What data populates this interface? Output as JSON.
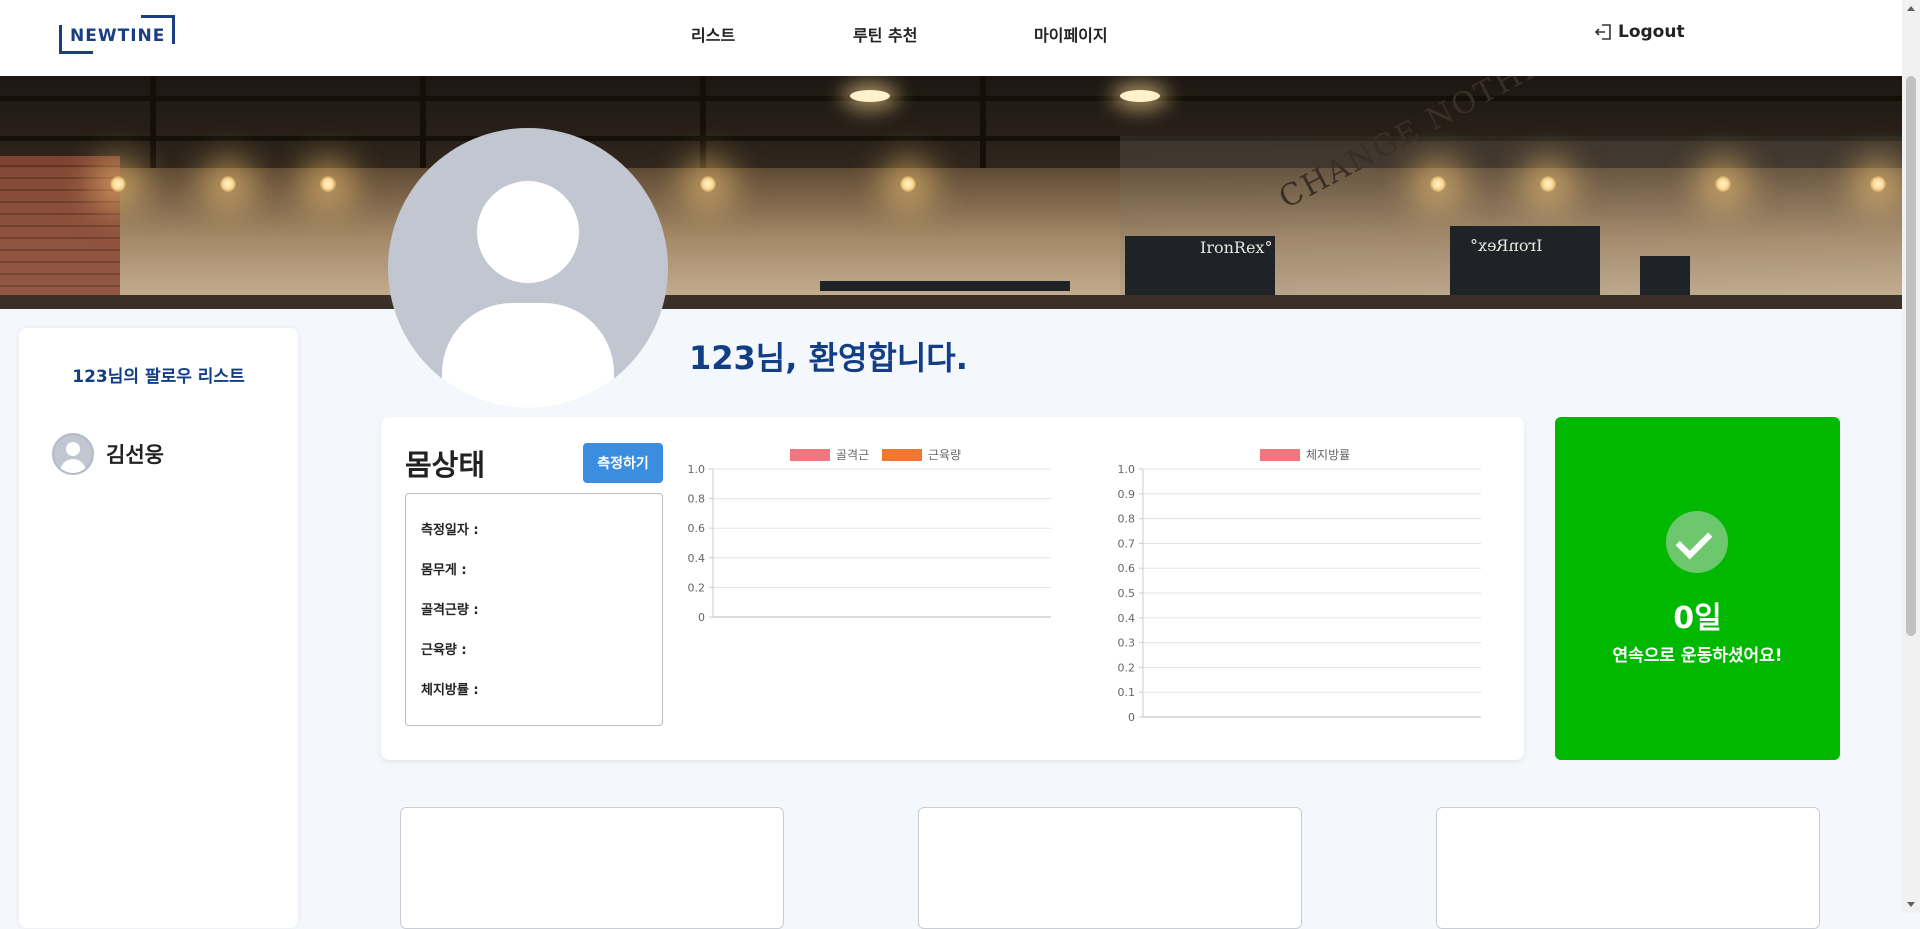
{
  "header": {
    "logo_text": "NEWTINE",
    "nav": [
      "리스트",
      "루틴 추천",
      "마이페이지"
    ],
    "logout_label": "Logout"
  },
  "banner": {
    "wall_text": "CHANGE NOTHI",
    "rack_labels": [
      "IronRex°",
      "IronRex°"
    ]
  },
  "profile": {
    "welcome": "123님, 환영합니다."
  },
  "sidebar": {
    "title": "123님의 팔로우 리스트",
    "follows": [
      {
        "name": "김선웅"
      }
    ]
  },
  "body_state": {
    "title": "몸상태",
    "measure_button": "측정하기",
    "fields": [
      {
        "label": "측정일자 :",
        "value": ""
      },
      {
        "label": "몸무게 :",
        "value": ""
      },
      {
        "label": "골격근량 :",
        "value": ""
      },
      {
        "label": "근육량 :",
        "value": ""
      },
      {
        "label": "체지방률 :",
        "value": ""
      }
    ]
  },
  "streak": {
    "days": "0일",
    "message": "연속으로 운동하셨어요!",
    "color": "#00b800"
  },
  "colors": {
    "brand": "#123e86",
    "button": "#3b8de0",
    "series_pink": "#f07680",
    "series_orange": "#f07830"
  },
  "chart_data": [
    {
      "type": "line",
      "title": "",
      "legend_position": "top",
      "series": [
        {
          "name": "골격근",
          "values": [],
          "color": "#f07680"
        },
        {
          "name": "근육량",
          "values": [],
          "color": "#f07830"
        }
      ],
      "categories": [],
      "ylim": [
        0,
        1.0
      ],
      "yticks": [
        "0",
        "0.2",
        "0.4",
        "0.6",
        "0.8",
        "1.0"
      ],
      "grid": true
    },
    {
      "type": "line",
      "title": "",
      "legend_position": "top",
      "series": [
        {
          "name": "체지방률",
          "values": [],
          "color": "#f07680"
        }
      ],
      "categories": [],
      "ylim": [
        0,
        1.0
      ],
      "yticks": [
        "0",
        "0.1",
        "0.2",
        "0.3",
        "0.4",
        "0.5",
        "0.6",
        "0.7",
        "0.8",
        "0.9",
        "1.0"
      ],
      "grid": true
    }
  ],
  "bottom_cards": [
    "",
    "",
    ""
  ]
}
